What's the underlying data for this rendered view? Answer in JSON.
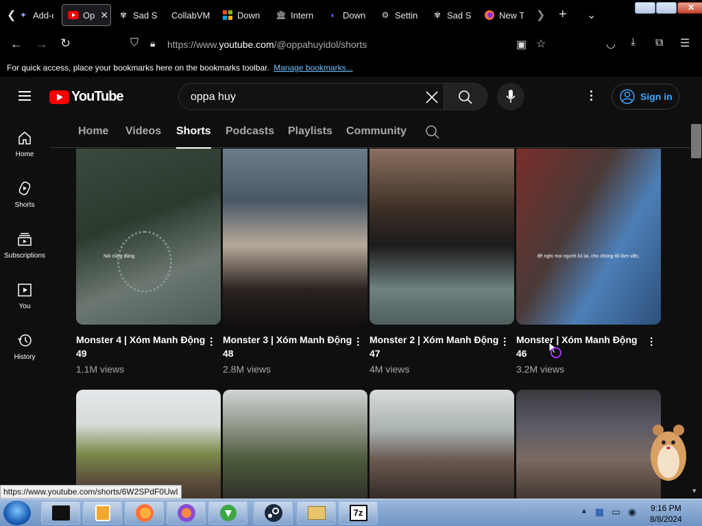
{
  "browser": {
    "tabs": [
      {
        "label": "Add-o"
      },
      {
        "label": "Op",
        "active": true
      },
      {
        "label": "Sad S"
      },
      {
        "label": "CollabVM"
      },
      {
        "label": "Down"
      },
      {
        "label": "Intern"
      },
      {
        "label": "Down"
      },
      {
        "label": "Settin"
      },
      {
        "label": "Sad S"
      },
      {
        "label": "New T"
      }
    ],
    "url_prefix": "https://www.",
    "url_domain": "youtube.com",
    "url_path": "/@oppahuyidol/shorts",
    "bookmarks_text": "For quick access, place your bookmarks here on the bookmarks toolbar.",
    "bookmarks_link": "Manage bookmarks...",
    "status_url": "https://www.youtube.com/shorts/6W2SPdF0UwI"
  },
  "youtube": {
    "logo_text": "YouTube",
    "search_value": "oppa huy",
    "sign_in": "Sign in",
    "sidebar": [
      {
        "label": "Home"
      },
      {
        "label": "Shorts"
      },
      {
        "label": "Subscriptions"
      },
      {
        "label": "You"
      },
      {
        "label": "History"
      }
    ],
    "channel_tabs": [
      {
        "label": "Home"
      },
      {
        "label": "Videos"
      },
      {
        "label": "Shorts",
        "active": true
      },
      {
        "label": "Podcasts"
      },
      {
        "label": "Playlists"
      },
      {
        "label": "Community"
      }
    ],
    "shorts": [
      {
        "title": "Monster 4 | Xóm Manh Động 49",
        "views": "1.1M views",
        "caption": "Nói cũng đúng"
      },
      {
        "title": "Monster 3 | Xóm Manh Động 48",
        "views": "2.8M views",
        "caption": ""
      },
      {
        "title": "Monster 2 | Xóm Manh Động 47",
        "views": "4M views",
        "caption": ""
      },
      {
        "title": "Monster | Xóm Manh Động 46",
        "views": "3.2M views",
        "caption": "đề nghị mọi người lùi lại, cho chúng tôi làm việc."
      }
    ]
  },
  "taskbar": {
    "time": "9:16 PM",
    "date": "8/8/2024",
    "apps": [
      "vm-box-icon",
      "media-player-icon",
      "firefox-icon",
      "browser-icon",
      "download-manager-icon",
      "steam-icon",
      "file-explorer-icon",
      "7zip-icon"
    ]
  },
  "colors": {
    "accent": "#ff0000",
    "link": "#3ea6ff",
    "background": "#0f0f0f"
  }
}
